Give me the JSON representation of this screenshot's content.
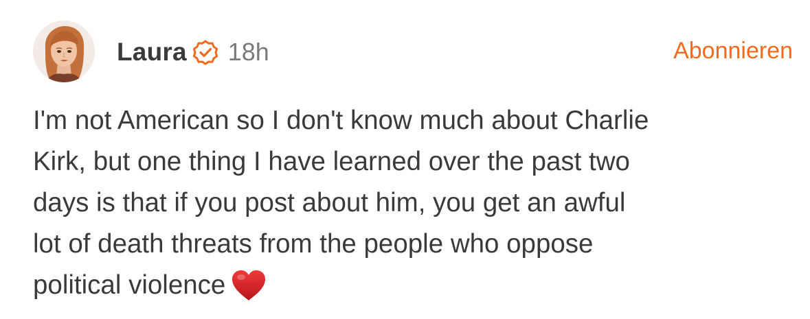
{
  "post": {
    "author": {
      "name": "Laura",
      "verified_icon": "verified-badge-icon",
      "avatar": "avatar"
    },
    "time": "18h",
    "subscribe_label": "Abonnieren",
    "body_lines": [
      "I'm not American so I don't know much about Charlie",
      "Kirk, but one thing I have learned over the past two",
      "days is that if you post about him, you get an awful",
      "lot of death threats from the people who oppose",
      "political violence"
    ],
    "emoji": "heart-emoji-icon"
  },
  "colors": {
    "accent": "#f26a1b",
    "text": "#3a3a3c",
    "muted": "#7a7a7e",
    "heart": "#d81e25"
  }
}
